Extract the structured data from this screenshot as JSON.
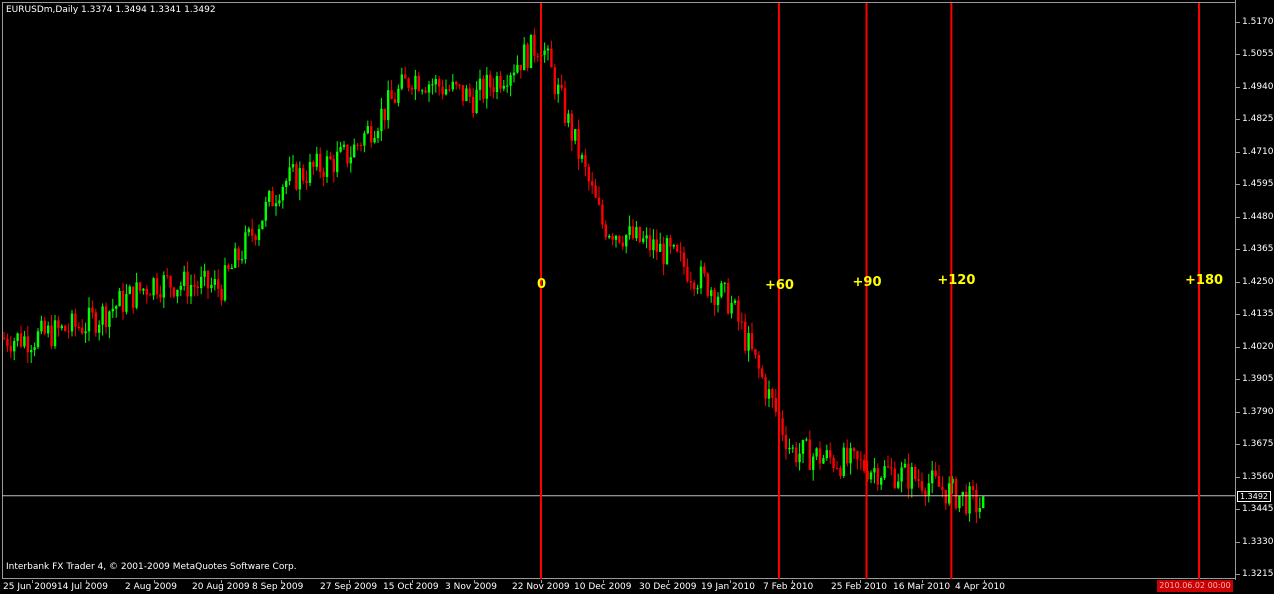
{
  "chart_title": "EURUSDm,Daily  1.3374 1.3494 1.3341 1.3492",
  "copyright": "Interbank FX Trader 4, © 2001-2009 MetaQuotes Software Corp.",
  "current_price": "1.3492",
  "end_date": "2010.06.02 00:00",
  "colors": {
    "bull": "#00ff00",
    "bear": "#ff0000",
    "marker": "#ff0000",
    "label": "#ffff00",
    "background": "#000000",
    "grid_line": "#9a9a9a"
  },
  "price_scale": {
    "labels": [
      "1.5170",
      "1.5055",
      "1.4940",
      "1.4825",
      "1.4710",
      "1.4595",
      "1.4480",
      "1.4365",
      "1.4250",
      "1.4135",
      "1.4020",
      "1.3905",
      "1.3790",
      "1.3675",
      "1.3560",
      "1.3445",
      "1.3330",
      "1.3215"
    ]
  },
  "time_scale": {
    "labels": [
      "25 Jun 2009",
      "14 Jul 2009",
      "2 Aug 2009",
      "20 Aug 2009",
      "8 Sep 2009",
      "27 Sep 2009",
      "15 Oct 2009",
      "3 Nov 2009",
      "22 Nov 2009",
      "10 Dec 2009",
      "30 Dec 2009",
      "19 Jan 2010",
      "7 Feb 2010",
      "25 Feb 2010",
      "16 Mar 2010",
      "4 Apr 2010"
    ]
  },
  "cycle_markers": [
    {
      "label": "0",
      "date": "2009-11-25"
    },
    {
      "label": "+60",
      "date": "2010-02-03"
    },
    {
      "label": "+90",
      "date": "2010-02-27"
    },
    {
      "label": "+120",
      "date": "2010-03-25"
    },
    {
      "label": "+180",
      "date": "2010-06-02"
    }
  ],
  "chart_data": {
    "type": "candlestick",
    "symbol": "EURUSDm",
    "timeframe": "Daily",
    "ylim": [
      1.3215,
      1.517
    ],
    "last_close": 1.3492,
    "x": [
      "2009-06-25",
      "2009-07-14",
      "2009-08-02",
      "2009-08-20",
      "2009-09-08",
      "2009-09-27",
      "2009-10-15",
      "2009-11-03",
      "2009-11-25",
      "2009-12-10",
      "2009-12-30",
      "2010-01-19",
      "2010-02-07",
      "2010-02-25",
      "2010-03-16",
      "2010-04-04",
      "2010-04-16"
    ],
    "close": [
      1.405,
      1.41,
      1.425,
      1.423,
      1.46,
      1.47,
      1.498,
      1.49,
      1.51,
      1.445,
      1.435,
      1.418,
      1.365,
      1.36,
      1.355,
      1.345,
      1.3492
    ]
  }
}
